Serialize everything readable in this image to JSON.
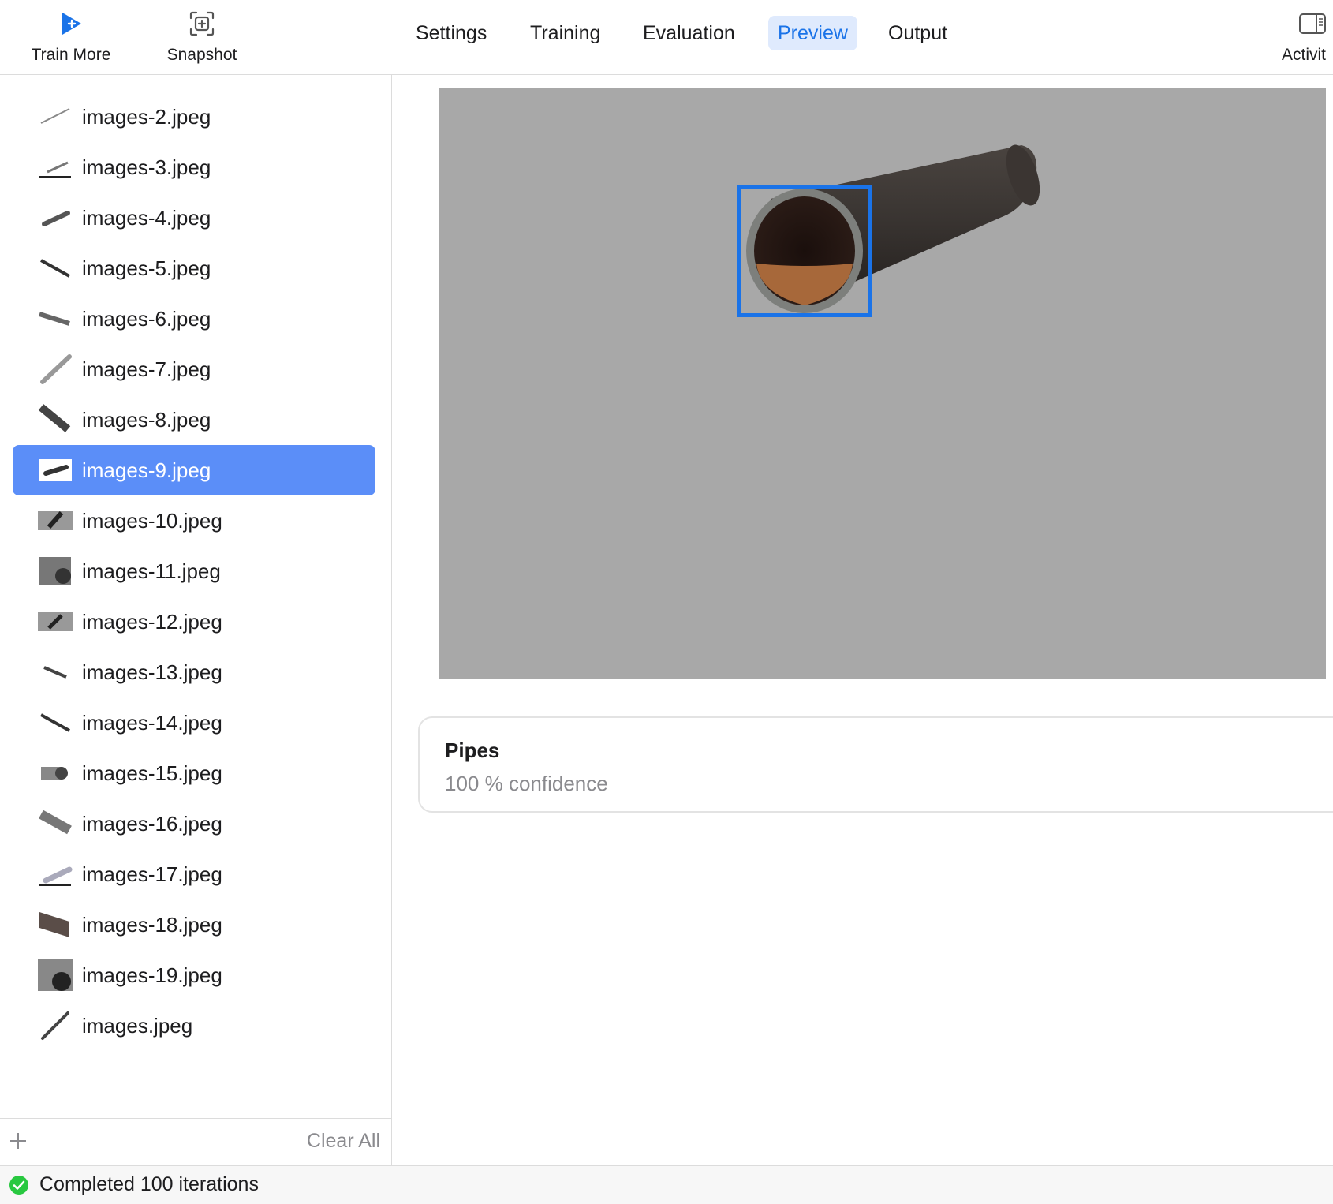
{
  "toolbar": {
    "train_more_label": "Train More",
    "snapshot_label": "Snapshot",
    "activity_label": "Activit",
    "tabs": [
      {
        "label": "Settings",
        "active": false
      },
      {
        "label": "Training",
        "active": false
      },
      {
        "label": "Evaluation",
        "active": false
      },
      {
        "label": "Preview",
        "active": true
      },
      {
        "label": "Output",
        "active": false
      }
    ],
    "icons": {
      "train_more": "play-plus-icon",
      "snapshot": "snapshot-icon",
      "activity": "sidebar-toggle-icon"
    }
  },
  "sidebar": {
    "files": [
      {
        "name": "images-2.jpeg",
        "selected": false
      },
      {
        "name": "images-3.jpeg",
        "selected": false
      },
      {
        "name": "images-4.jpeg",
        "selected": false
      },
      {
        "name": "images-5.jpeg",
        "selected": false
      },
      {
        "name": "images-6.jpeg",
        "selected": false
      },
      {
        "name": "images-7.jpeg",
        "selected": false
      },
      {
        "name": "images-8.jpeg",
        "selected": false
      },
      {
        "name": "images-9.jpeg",
        "selected": true
      },
      {
        "name": "images-10.jpeg",
        "selected": false
      },
      {
        "name": "images-11.jpeg",
        "selected": false
      },
      {
        "name": "images-12.jpeg",
        "selected": false
      },
      {
        "name": "images-13.jpeg",
        "selected": false
      },
      {
        "name": "images-14.jpeg",
        "selected": false
      },
      {
        "name": "images-15.jpeg",
        "selected": false
      },
      {
        "name": "images-16.jpeg",
        "selected": false
      },
      {
        "name": "images-17.jpeg",
        "selected": false
      },
      {
        "name": "images-18.jpeg",
        "selected": false
      },
      {
        "name": "images-19.jpeg",
        "selected": false
      },
      {
        "name": "images.jpeg",
        "selected": false
      }
    ],
    "add_icon": "plus-icon",
    "clear_all_label": "Clear All"
  },
  "preview": {
    "result_label": "Pipes",
    "confidence_text": "100 % confidence",
    "bbox_color": "#1a73e8"
  },
  "status": {
    "text": "Completed 100 iterations",
    "icon": "checkmark-circle-icon",
    "icon_color": "#28c840"
  },
  "colors": {
    "accent": "#1a73e8",
    "selection": "#5b8ef8",
    "preview_background": "#a8a8a8"
  }
}
